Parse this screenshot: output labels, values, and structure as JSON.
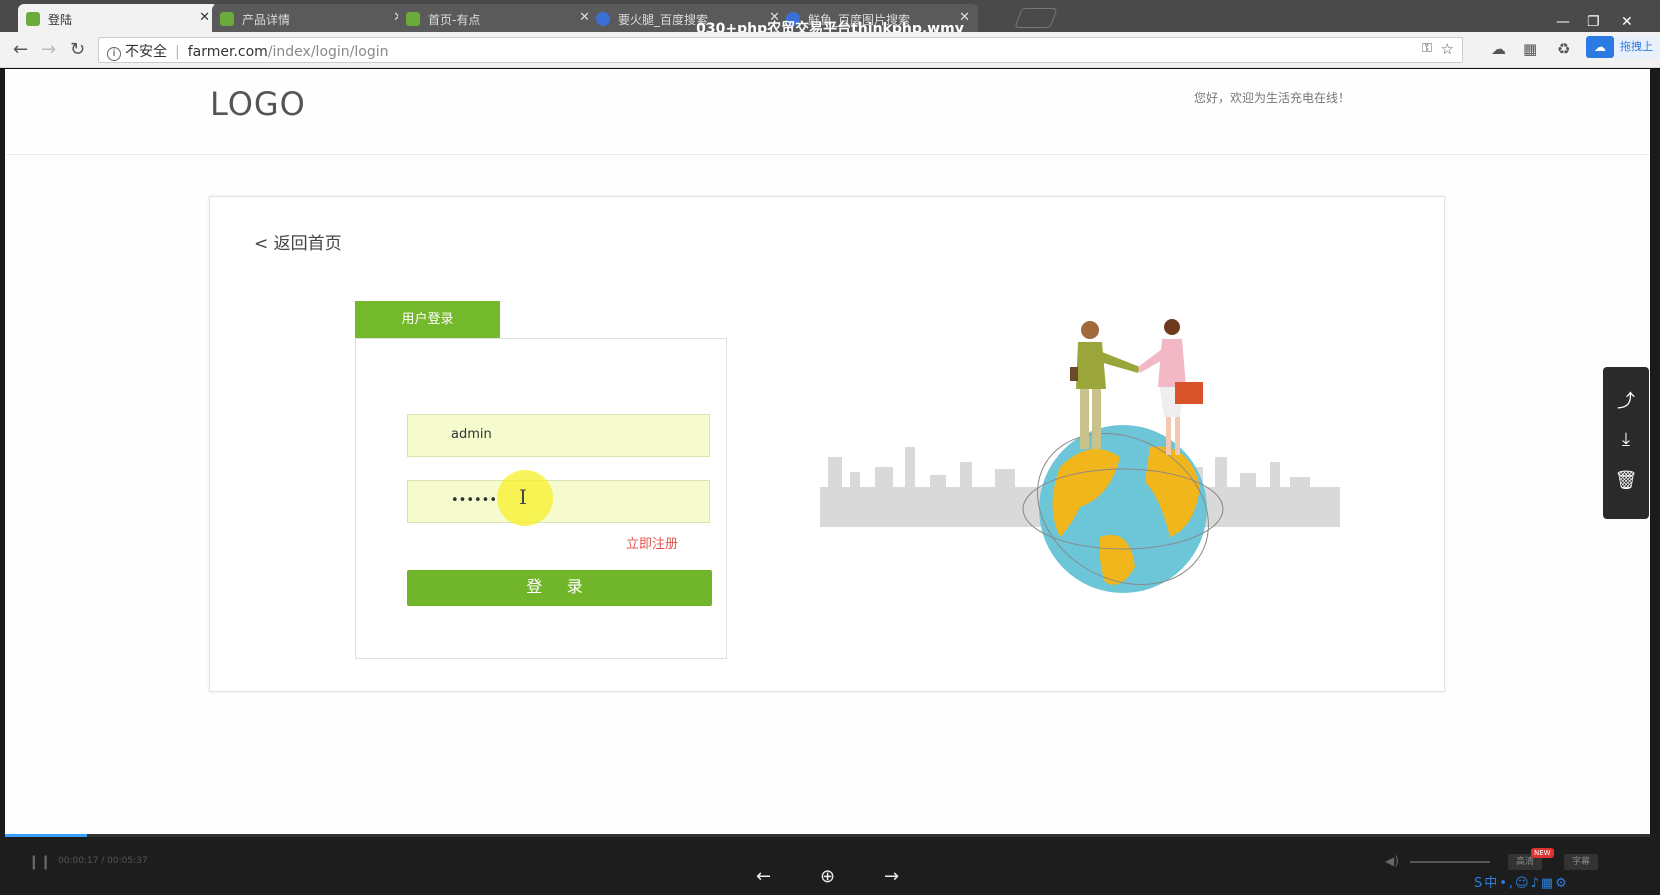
{
  "browser": {
    "video_title": "030+php农贸交易平台thinkphp.wmv",
    "tabs": [
      {
        "title": "登陆",
        "active": true
      },
      {
        "title": "产品详情",
        "active": false
      },
      {
        "title": "首页-有点",
        "active": false
      },
      {
        "title": "要火腿_百度搜索",
        "active": false
      },
      {
        "title": "鲜鱼_百度图片搜索",
        "active": false
      }
    ],
    "security_label": "不安全",
    "url_host": "farmer.com",
    "url_path": "/index/login/login",
    "ext_text": "拖拽上"
  },
  "page": {
    "logo": "LOGO",
    "welcome": "您好，欢迎为生活充电在线！",
    "back_link": "< 返回首页",
    "login_tab": "用户登录",
    "username_value": "admin",
    "password_value": "••••••",
    "register_link": "立即注册",
    "login_button": "登 录"
  },
  "player": {
    "timecode": "00:00:17 / 00:05:37",
    "progress_fraction": 0.05,
    "btn_hd": "高清",
    "btn_sub": "字幕",
    "new_badge": "NEW"
  },
  "colors": {
    "accent_green": "#74b92b",
    "input_fill": "#f6fbcd",
    "register_red": "#e8554e",
    "progress_blue": "#3aa0ff"
  }
}
